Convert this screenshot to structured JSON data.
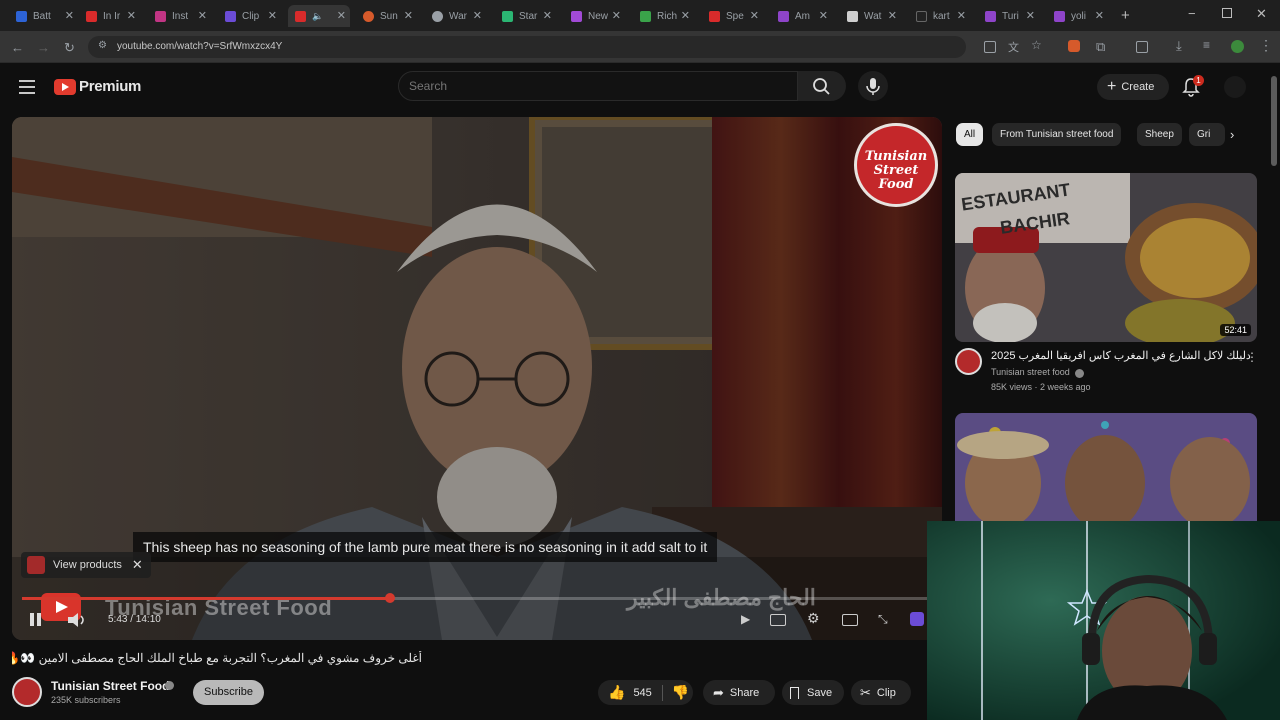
{
  "browser": {
    "tabs": [
      {
        "label": "Batt",
        "color": "#2d63d6"
      },
      {
        "label": "In Ir",
        "color": "#d92b2b"
      },
      {
        "label": "Inst",
        "color": "#c13584"
      },
      {
        "label": "Clip",
        "color": "#6b4cd6"
      },
      {
        "label": "",
        "color": "#d92b2b"
      },
      {
        "label": "Sun",
        "color": "#d65a2b"
      },
      {
        "label": "War",
        "color": "#9aa0a6"
      },
      {
        "label": "Star",
        "color": "#2bb673"
      },
      {
        "label": "New",
        "color": "#a14ad6"
      },
      {
        "label": "Rich",
        "color": "#3aa34a"
      },
      {
        "label": "Spe",
        "color": "#d92b2b"
      },
      {
        "label": "Am",
        "color": "#8e44c9"
      },
      {
        "label": "Wat",
        "color": "#cfcfcf"
      },
      {
        "label": "kart",
        "color": "#222222"
      },
      {
        "label": "Turi",
        "color": "#8e44c9"
      },
      {
        "label": "yoli",
        "color": "#8e44c9"
      }
    ],
    "url": "youtube.com/watch?v=SrfWmxzcx4Y"
  },
  "header": {
    "logo_text": "Premium",
    "search_placeholder": "Search",
    "create_label": "Create",
    "notification_count": "1"
  },
  "player": {
    "subtitle": "This sheep has no seasoning of the lamb pure meat there is no seasoning in it add salt to it",
    "view_products_label": "View products",
    "time": "5:43 / 14:10",
    "progress": 0.404,
    "overlay_title": "Tunisian Street Food",
    "overlay_arabic": "الحاج مصطفى الكبير",
    "brand_logo_text": "Tunisian Street Food"
  },
  "video": {
    "title": "أغلى خروف مشوي في المغرب؟ التجربة مع طباخ الملك الحاج مصطفى الامين 👀🔥",
    "channel_name": "Tunisian Street Food",
    "subscribers": "235K subscribers",
    "subscribe_label": "Subscribe",
    "like_count": "545",
    "share_label": "Share",
    "save_label": "Save",
    "clip_label": "Clip"
  },
  "sidebar": {
    "chips": [
      "All",
      "From Tunisian street food",
      "Sheep",
      "Gri"
    ],
    "recommendations": [
      {
        "thumb_text_1": "ESTAURANT",
        "thumb_text_2": "BACHIR",
        "duration": "52:41",
        "title": "دليلك لاكل الشارع في المغرب كاس افريقيا المغرب 2025",
        "channel": "Tunisian street food",
        "meta": "85K views · 2 weeks ago"
      }
    ]
  },
  "colors": {
    "accent_red": "#d43a2e",
    "background": "#0f0f0f"
  }
}
